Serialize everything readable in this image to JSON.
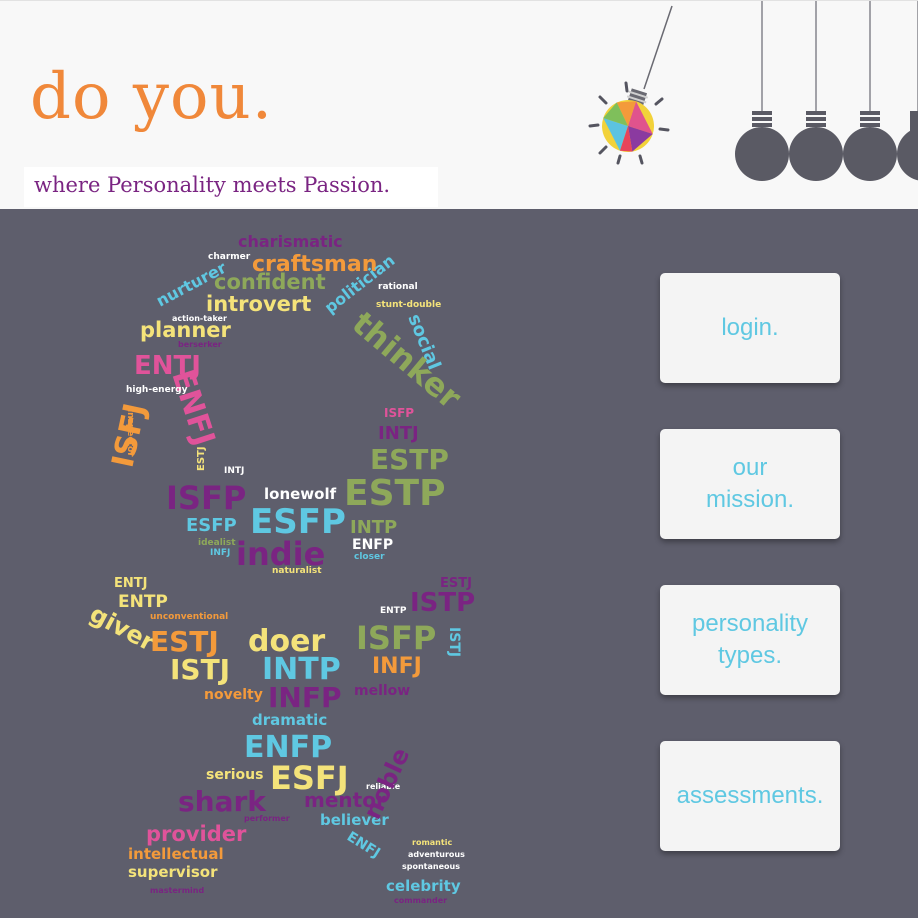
{
  "brand": {
    "title": "do you.",
    "tagline": "where Personality meets Passion."
  },
  "menu": [
    {
      "label": "login."
    },
    {
      "label": "our\nmission."
    },
    {
      "label": "personality\ntypes."
    },
    {
      "label": "assessments."
    }
  ],
  "colors": {
    "brand_orange": "#f0883a",
    "tagline_purple": "#7a2482",
    "panel_gray": "#5e5e6c",
    "button_text": "#5fc8e2",
    "bulb_gray": "#5a5a64"
  },
  "word_cloud": {
    "words": [
      "charismatic",
      "charmer",
      "craftsman",
      "nurturer",
      "confident",
      "politician",
      "introvert",
      "rational",
      "stunt-double",
      "action-taker",
      "social",
      "planner",
      "thinker",
      "berserker",
      "ENTJ",
      "ENFJ",
      "high-energy",
      "inspector",
      "ISFJ",
      "ISFP",
      "INTJ",
      "ESTP",
      "ESTJ",
      "INTJ",
      "ESTP",
      "ISFP",
      "lonewolf",
      "ESFP",
      "ESFP",
      "INTP",
      "idealist",
      "ENFP",
      "INFJ",
      "indie",
      "closer",
      "naturalist",
      "ENTJ",
      "ESTJ",
      "ENTP",
      "ISTP",
      "unconventional",
      "ENTP",
      "giver",
      "ESTJ",
      "doer",
      "ISFP",
      "ISTJ",
      "ISTJ",
      "INTP",
      "INFJ",
      "novelty",
      "INFP",
      "mellow",
      "dramatic",
      "ENFP",
      "serious",
      "ESFJ",
      "reliable",
      "shark",
      "mentor",
      "performer",
      "believer",
      "provider",
      "ENFJ",
      "noble",
      "romantic",
      "adventurous",
      "intellectual",
      "spontaneous",
      "supervisor",
      "celebrity",
      "mastermind",
      "commander"
    ]
  }
}
